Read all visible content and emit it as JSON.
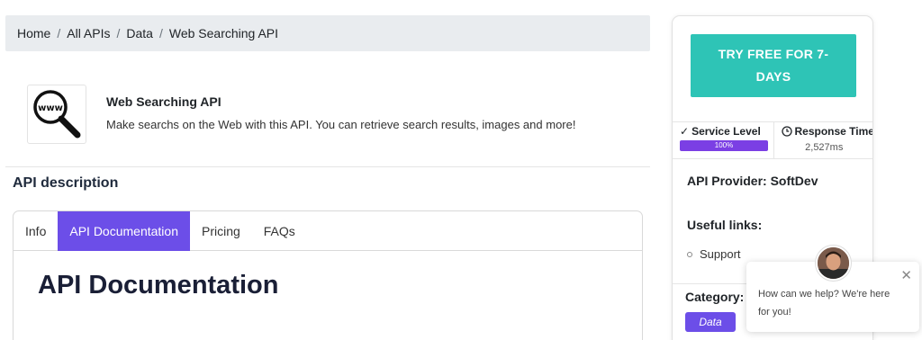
{
  "breadcrumb": {
    "items": [
      "Home",
      "All APIs",
      "Data",
      "Web Searching API"
    ],
    "separator": "/"
  },
  "api": {
    "logo_icon": "www-magnifier-icon",
    "title": "Web Searching API",
    "description": "Make searchs on the Web with this API. You can retrieve search results, images and more!"
  },
  "section_title": "API description",
  "tabs": [
    {
      "label": "Info",
      "active": false
    },
    {
      "label": "API Documentation",
      "active": true
    },
    {
      "label": "Pricing",
      "active": false
    },
    {
      "label": "FAQs",
      "active": false
    }
  ],
  "doc_heading": "API Documentation",
  "sidebar": {
    "try_button_line1": "TRY FREE FOR 7-",
    "try_button_line2": "DAYS",
    "service_level": {
      "icon": "check-icon",
      "label": "Service Level",
      "value_text": "100%",
      "value": 100
    },
    "response_time": {
      "icon": "clock-icon",
      "label": "Response Time",
      "value": "2,527ms"
    },
    "provider": "API Provider: SoftDev",
    "useful_links_title": "Useful links:",
    "links": [
      "Support"
    ],
    "category_label": "Category:",
    "category_value": "Data"
  },
  "chat": {
    "message_line1": "How can we help? We're here",
    "message_line2": "for you!",
    "close_symbol": "✕"
  },
  "colors": {
    "accent": "#6c4ee8",
    "try_button": "#2ec4b6",
    "breadcrumb_bg": "#e9ecef",
    "service_bar": "#7b3fe4"
  }
}
